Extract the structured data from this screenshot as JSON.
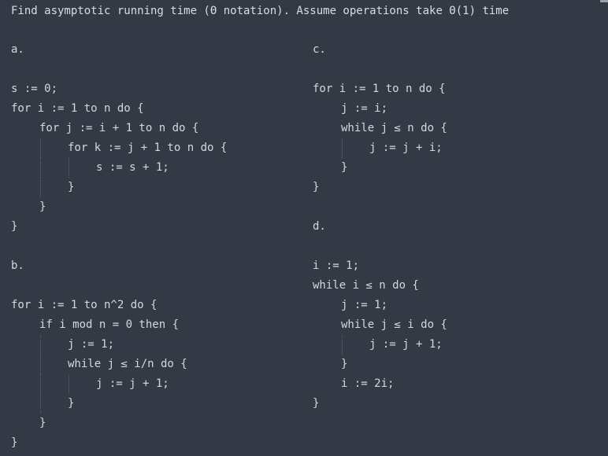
{
  "title": "Find asymptotic running time (Θ notation). Assume operations take Θ(1) time",
  "problems": {
    "a": {
      "label": "a.",
      "lines": [
        {
          "text": "s := 0;",
          "indent": 0
        },
        {
          "text": "for i := 1 to n do {",
          "indent": 0
        },
        {
          "text": "for j := i + 1 to n do {",
          "indent": 1
        },
        {
          "text": "for k := j + 1 to n do {",
          "indent": 2
        },
        {
          "text": "s := s + 1;",
          "indent": 3
        },
        {
          "text": "}",
          "indent": 2
        },
        {
          "text": "}",
          "indent": 1
        },
        {
          "text": "}",
          "indent": 0
        }
      ]
    },
    "b": {
      "label": "b.",
      "lines": [
        {
          "text": "for i := 1 to n^2 do {",
          "indent": 0
        },
        {
          "text": "if i mod n = 0 then {",
          "indent": 1
        },
        {
          "text": "j := 1;",
          "indent": 2
        },
        {
          "text": "while j ≤ i/n do {",
          "indent": 2
        },
        {
          "text": "j := j + 1;",
          "indent": 3
        },
        {
          "text": "}",
          "indent": 2
        },
        {
          "text": "}",
          "indent": 1
        },
        {
          "text": "}",
          "indent": 0
        }
      ]
    },
    "c": {
      "label": "c.",
      "lines": [
        {
          "text": "for i := 1 to n do {",
          "indent": 0
        },
        {
          "text": "j := i;",
          "indent": 1
        },
        {
          "text": "while j ≤ n do {",
          "indent": 1
        },
        {
          "text": "j := j + i;",
          "indent": 2
        },
        {
          "text": "}",
          "indent": 1
        },
        {
          "text": "}",
          "indent": 0
        }
      ]
    },
    "d": {
      "label": "d.",
      "lines": [
        {
          "text": "i := 1;",
          "indent": 0
        },
        {
          "text": "while i ≤ n do {",
          "indent": 0
        },
        {
          "text": "j := 1;",
          "indent": 1
        },
        {
          "text": "while j ≤ i do {",
          "indent": 1
        },
        {
          "text": "j := j + 1;",
          "indent": 2
        },
        {
          "text": "}",
          "indent": 1
        },
        {
          "text": "i := 2i;",
          "indent": 1
        },
        {
          "text": "}",
          "indent": 0
        }
      ]
    }
  }
}
